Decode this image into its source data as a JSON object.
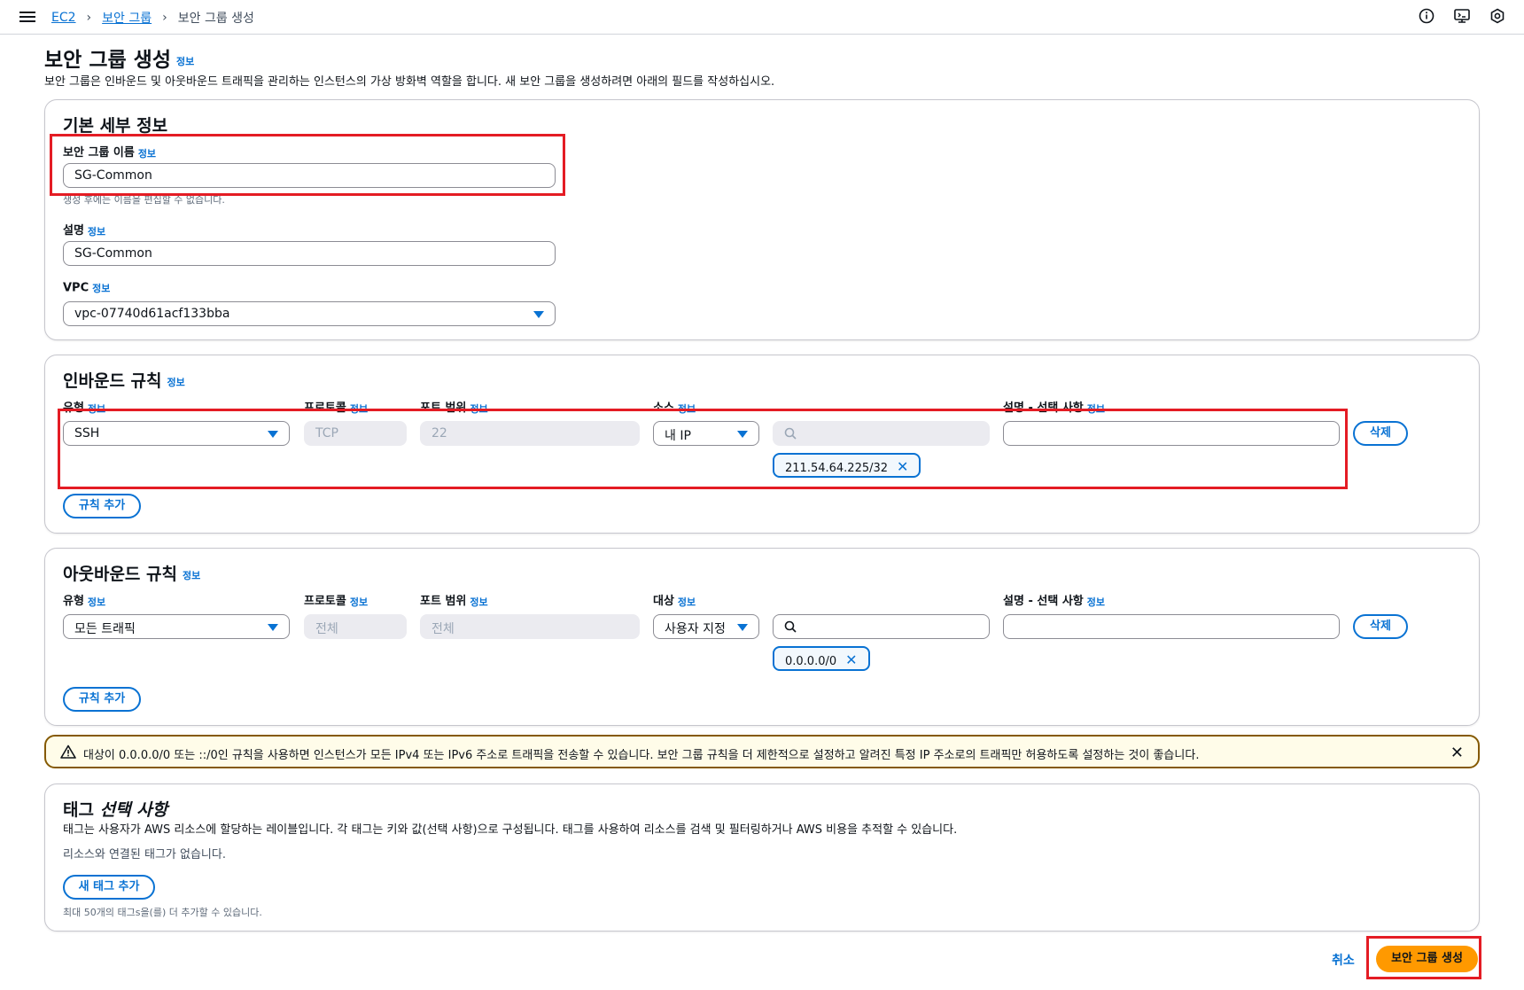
{
  "breadcrumb": {
    "items": [
      "EC2",
      "보안 그룹",
      "보안 그룹 생성"
    ]
  },
  "header": {
    "icons": [
      "info-icon",
      "feedback-icon",
      "settings-icon"
    ]
  },
  "page": {
    "title": "보안 그룹 생성",
    "info": "정보",
    "description": "보안 그룹은 인바운드 및 아웃바운드 트래픽을 관리하는 인스턴스의 가상 방화벽 역할을 합니다. 새 보안 그룹을 생성하려면 아래의 필드를 작성하십시오."
  },
  "basic": {
    "title": "기본 세부 정보",
    "name_label": "보안 그룹 이름",
    "name_value": "SG-Common",
    "name_hint": "생성 후에는 이름을 편집할 수 없습니다.",
    "desc_label": "설명",
    "desc_value": "SG-Common",
    "vpc_label": "VPC",
    "vpc_value": "vpc-07740d61acf133bba",
    "info": "정보"
  },
  "inbound": {
    "title": "인바운드 규칙",
    "info": "정보",
    "col_type": "유형",
    "col_protocol": "프로토콜",
    "col_port": "포트 범위",
    "col_source": "소스",
    "col_desc": "설명 - 선택 사항",
    "type_value": "SSH",
    "protocol_value": "TCP",
    "port_value": "22",
    "source_value": "내 IP",
    "token_value": "211.54.64.225/32",
    "delete_label": "삭제",
    "add_rule_label": "규칙 추가"
  },
  "outbound": {
    "title": "아웃바운드 규칙",
    "info": "정보",
    "col_type": "유형",
    "col_protocol": "프로토콜",
    "col_port": "포트 범위",
    "col_dest": "대상",
    "col_desc": "설명 - 선택 사항",
    "type_value": "모든 트래픽",
    "protocol_value": "전체",
    "port_value": "전체",
    "dest_value": "사용자 지정",
    "token_value": "0.0.0.0/0",
    "delete_label": "삭제",
    "add_rule_label": "규칙 추가"
  },
  "warning": {
    "text": "대상이 0.0.0.0/0 또는 ::/0인 규칙을 사용하면 인스턴스가 모든 IPv4 또는 IPv6 주소로 트래픽을 전송할 수 있습니다. 보안 그룹 규칙을 더 제한적으로 설정하고 알려진 특정 IP 주소로의 트래픽만 허용하도록 설정하는 것이 좋습니다."
  },
  "tags": {
    "title": "태그",
    "title_optional": "선택 사항",
    "description": "태그는 사용자가 AWS 리소스에 할당하는 레이블입니다. 각 태그는 키와 값(선택 사항)으로 구성됩니다. 태그를 사용하여 리소스를 검색 및 필터링하거나 AWS 비용을 추적할 수 있습니다.",
    "empty": "리소스와 연결된 태그가 없습니다.",
    "add_label": "새 태그 추가",
    "limit_hint": "최대 50개의 태그s을(를) 더 추가할 수 있습니다."
  },
  "footer": {
    "cancel_label": "취소",
    "create_label": "보안 그룹 생성"
  },
  "colors": {
    "accent": "#0972d3",
    "primary_button": "#ff9900",
    "highlight": "#e41c24"
  }
}
